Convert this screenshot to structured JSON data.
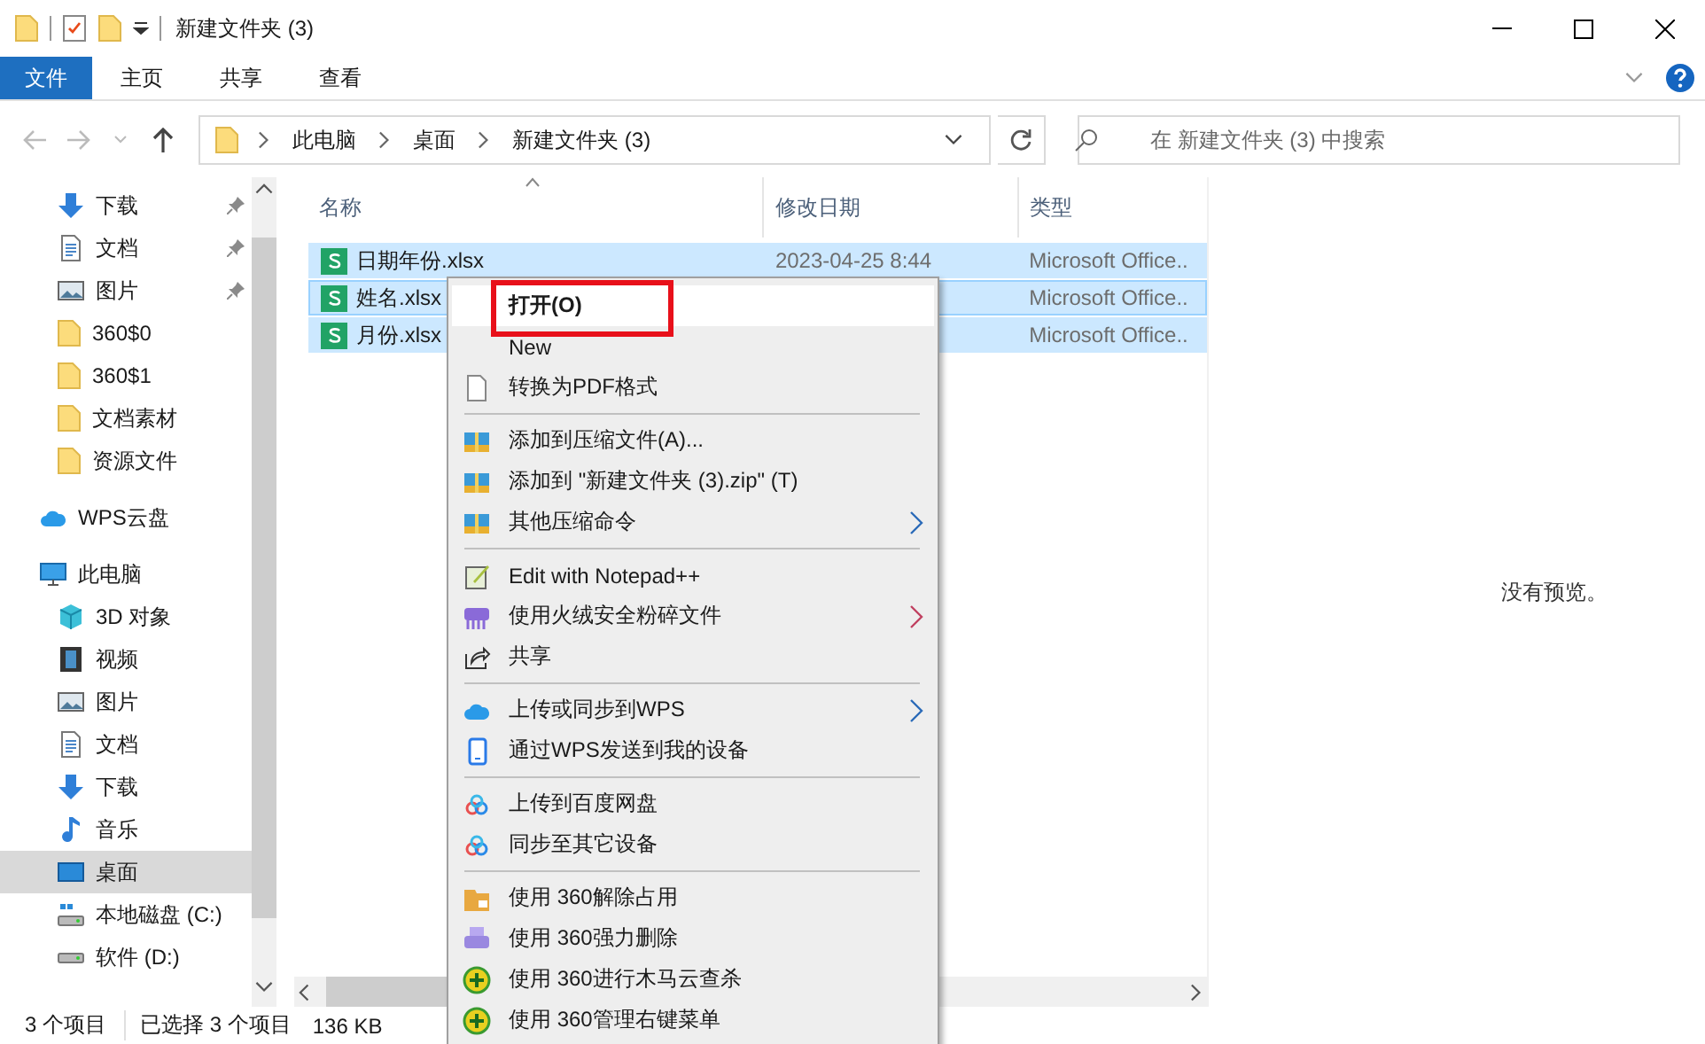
{
  "window": {
    "title": "新建文件夹 (3)"
  },
  "ribbon": {
    "tabs": [
      {
        "label": "文件",
        "selected": true
      },
      {
        "label": "主页",
        "selected": false
      },
      {
        "label": "共享",
        "selected": false
      },
      {
        "label": "查看",
        "selected": false
      }
    ]
  },
  "address_bar": {
    "path": [
      "此电脑",
      "桌面",
      "新建文件夹 (3)"
    ]
  },
  "search": {
    "placeholder": "在 新建文件夹 (3) 中搜索"
  },
  "sidebar": {
    "quick_access": [
      {
        "label": "下载",
        "pinned": true,
        "selected": false
      },
      {
        "label": "文档",
        "pinned": true,
        "selected": false
      },
      {
        "label": "图片",
        "pinned": true,
        "selected": false
      },
      {
        "label": "360$0",
        "pinned": false,
        "selected": false
      },
      {
        "label": "360$1",
        "pinned": false,
        "selected": false
      },
      {
        "label": "文档素材",
        "pinned": false,
        "selected": false
      },
      {
        "label": "资源文件",
        "pinned": false,
        "selected": false
      }
    ],
    "items": [
      {
        "label": "WPS云盘",
        "selected": false
      },
      {
        "label": "此电脑",
        "selected": false,
        "children": [
          {
            "label": "3D 对象",
            "selected": false
          },
          {
            "label": "视频",
            "selected": false
          },
          {
            "label": "图片",
            "selected": false
          },
          {
            "label": "文档",
            "selected": false
          },
          {
            "label": "下载",
            "selected": false
          },
          {
            "label": "音乐",
            "selected": false
          },
          {
            "label": "桌面",
            "selected": true
          },
          {
            "label": "本地磁盘 (C:)",
            "selected": false
          },
          {
            "label": "软件 (D:)",
            "selected": false
          }
        ]
      }
    ]
  },
  "file_list": {
    "columns": [
      "名称",
      "修改日期",
      "类型"
    ],
    "rows": [
      {
        "name": "日期年份.xlsx",
        "date": "2023-04-25 8:44",
        "type": "Microsoft Office..",
        "selected": true
      },
      {
        "name": "姓名.xlsx",
        "type": "Microsoft Office..",
        "selected": true
      },
      {
        "name": "月份.xlsx",
        "type": "Microsoft Office..",
        "selected": true
      }
    ]
  },
  "preview": {
    "message": "没有预览。"
  },
  "status_bar": {
    "count": "3 个项目",
    "selection": "已选择 3 个项目",
    "size": "136 KB"
  },
  "context_menu": {
    "groups": [
      {
        "items": [
          {
            "label": "打开(O)",
            "default": true,
            "selected": true,
            "highlighted": true,
            "submenu": false
          },
          {
            "label": "New",
            "default": false,
            "selected": false,
            "highlighted": false,
            "submenu": false
          },
          {
            "label": "转换为PDF格式",
            "default": false,
            "selected": false,
            "highlighted": false,
            "submenu": false
          }
        ]
      },
      {
        "items": [
          {
            "label": "添加到压缩文件(A)...",
            "default": false,
            "selected": false,
            "highlighted": false,
            "submenu": false
          },
          {
            "label": "添加到 \"新建文件夹 (3).zip\" (T)",
            "default": false,
            "selected": false,
            "highlighted": false,
            "submenu": false
          },
          {
            "label": "其他压缩命令",
            "default": false,
            "selected": false,
            "highlighted": false,
            "submenu": true
          }
        ]
      },
      {
        "items": [
          {
            "label": "Edit with Notepad++",
            "default": false,
            "selected": false,
            "highlighted": false,
            "submenu": false
          },
          {
            "label": "使用火绒安全粉碎文件",
            "default": false,
            "selected": false,
            "highlighted": false,
            "submenu": true
          },
          {
            "label": "共享",
            "default": false,
            "selected": false,
            "highlighted": false,
            "submenu": false
          }
        ]
      },
      {
        "items": [
          {
            "label": "上传或同步到WPS",
            "default": false,
            "selected": false,
            "highlighted": false,
            "submenu": true
          },
          {
            "label": "通过WPS发送到我的设备",
            "default": false,
            "selected": false,
            "highlighted": false,
            "submenu": false
          }
        ]
      },
      {
        "items": [
          {
            "label": "上传到百度网盘",
            "default": false,
            "selected": false,
            "highlighted": false,
            "submenu": false
          },
          {
            "label": "同步至其它设备",
            "default": false,
            "selected": false,
            "highlighted": false,
            "submenu": false
          }
        ]
      },
      {
        "items": [
          {
            "label": "使用 360解除占用",
            "default": false,
            "selected": false,
            "highlighted": false,
            "submenu": false
          },
          {
            "label": "使用 360强力删除",
            "default": false,
            "selected": false,
            "highlighted": false,
            "submenu": false
          },
          {
            "label": "使用 360进行木马云查杀",
            "default": false,
            "selected": false,
            "highlighted": false,
            "submenu": false
          },
          {
            "label": "使用 360管理右键菜单",
            "default": false,
            "selected": false,
            "highlighted": false,
            "submenu": false
          }
        ]
      }
    ]
  }
}
